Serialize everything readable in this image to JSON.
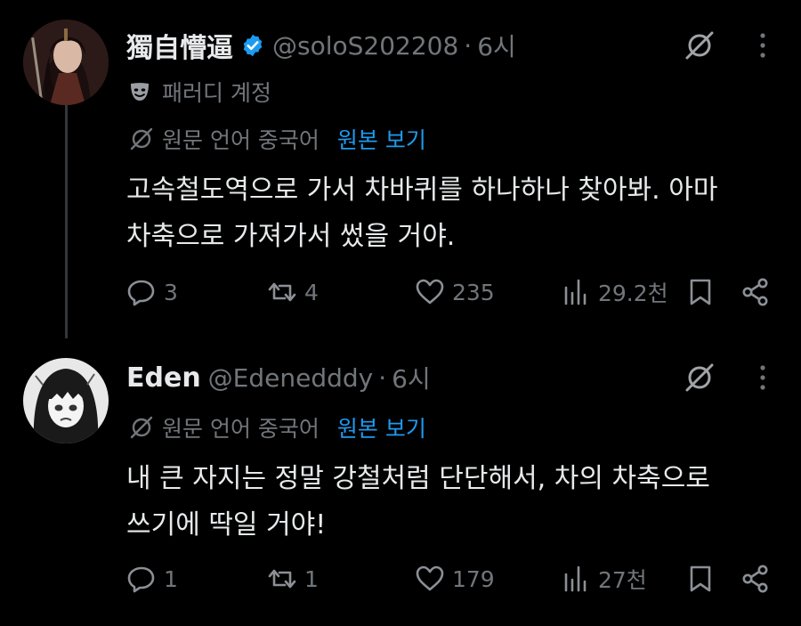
{
  "tweets": [
    {
      "display_name": "獨自懵逼",
      "handle": "@soloS202208",
      "separator": "·",
      "time": "6시",
      "verified": true,
      "badge_icon": "parody-mask-icon",
      "badge_label": "패러디 계정",
      "translate_label": "원문 언어 중국어",
      "translate_link": "원본 보기",
      "text": "고속철도역으로 가서 차바퀴를 하나하나 찾아봐. 아마\n차축으로 가져가서 썼을 거야.",
      "stats": {
        "replies": "3",
        "reposts": "4",
        "likes": "235",
        "views": "29.2천"
      }
    },
    {
      "display_name": "Eden",
      "handle": "@Edenedddy",
      "separator": "·",
      "time": "6시",
      "verified": false,
      "translate_label": "원문 언어 중국어",
      "translate_link": "원본 보기",
      "text": "내 큰 자지는 정말 강철처럼 단단해서, 차의 차축으로\n쓰기에 딱일 거야!",
      "stats": {
        "replies": "1",
        "reposts": "1",
        "likes": "179",
        "views": "27천"
      }
    }
  ],
  "colors": {
    "background": "#000000",
    "text_primary": "#e7e9ea",
    "text_secondary": "#71767b",
    "link": "#1d9bf0",
    "verified": "#1d9bf0",
    "thread_line": "#333639"
  }
}
